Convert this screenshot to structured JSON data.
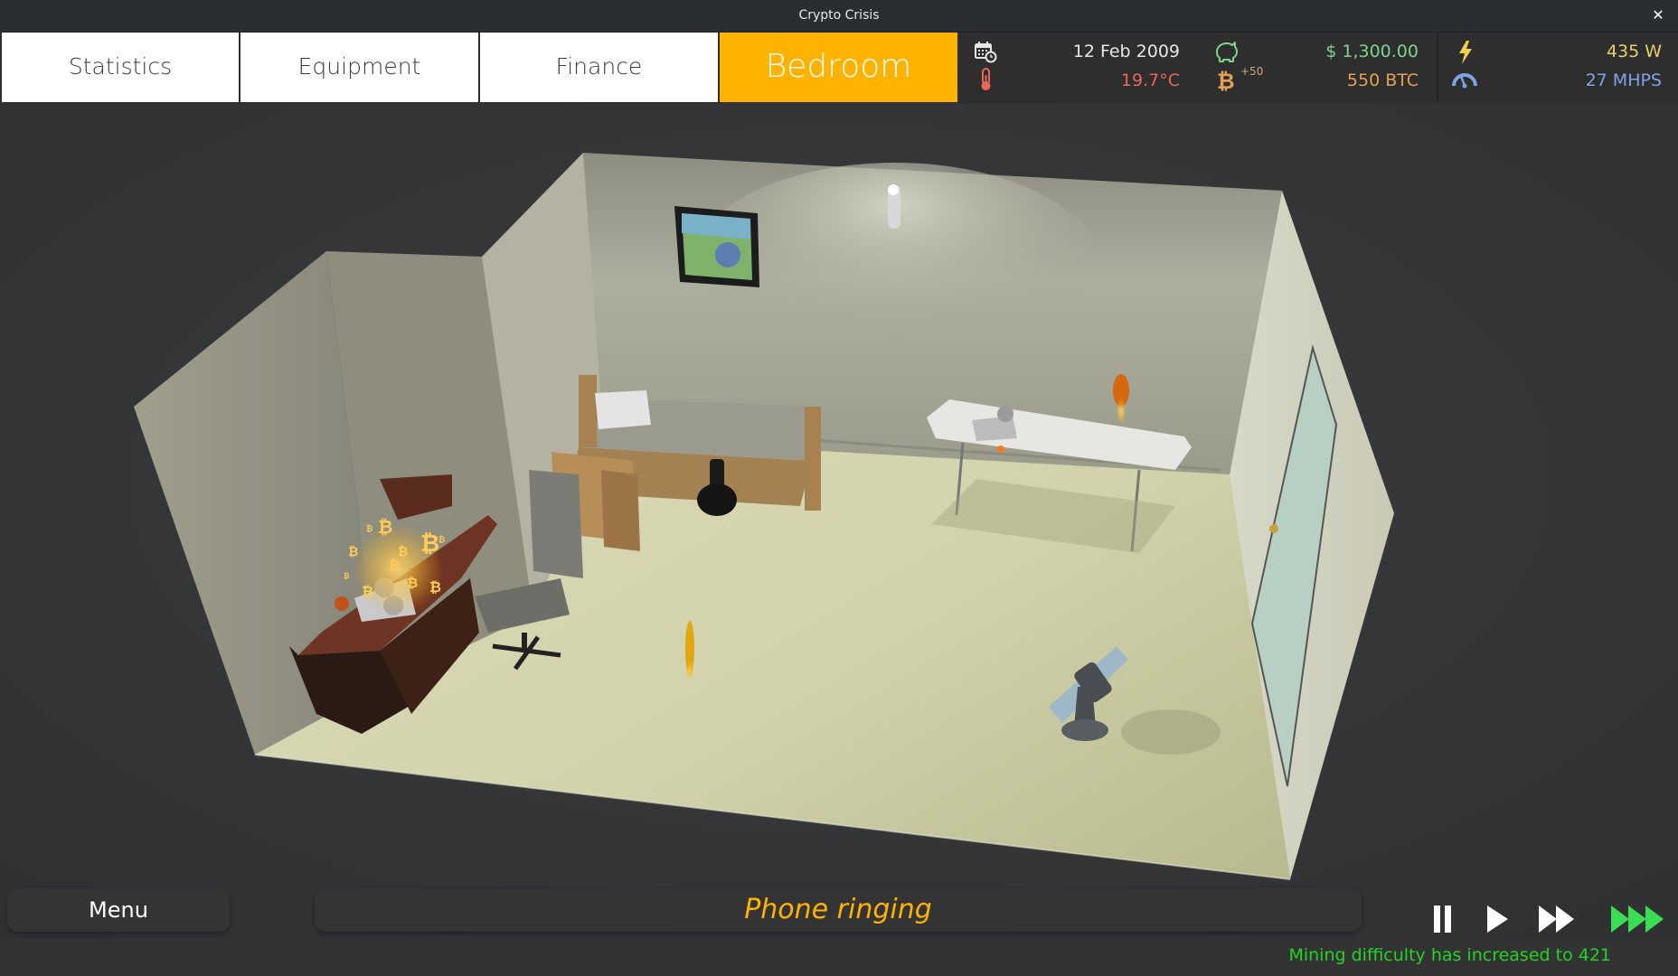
{
  "window": {
    "title": "Crypto Crisis",
    "close_icon": "close-icon"
  },
  "tabs": [
    {
      "label": "Statistics",
      "active": false
    },
    {
      "label": "Equipment",
      "active": false
    },
    {
      "label": "Finance",
      "active": false
    },
    {
      "label": "Bedroom",
      "active": true
    }
  ],
  "stats": {
    "date": {
      "icon": "calendar-clock-icon",
      "value": "12 Feb 2009",
      "color": "#e6e6e6"
    },
    "temperature": {
      "icon": "thermometer-icon",
      "value": "19.7°C",
      "color": "#e8675a"
    },
    "money": {
      "icon": "piggy-bank-icon",
      "value": "$ 1,300.00",
      "color": "#7ed38e"
    },
    "btc": {
      "icon": "bitcoin-icon",
      "value": "550 BTC",
      "delta": "+50",
      "color": "#e6a055"
    },
    "power": {
      "icon": "lightning-icon",
      "value": "435 W",
      "color": "#e8d070"
    },
    "hashrate": {
      "icon": "speedometer-icon",
      "value": "27 MHPS",
      "color": "#7ea4e6"
    }
  },
  "scene": {
    "room": "Bedroom",
    "objects": [
      "desk",
      "mining-rig",
      "office-chair",
      "nightstand",
      "bed",
      "picture-frame",
      "wall-lamp",
      "folding-table",
      "mining-rig-2",
      "wall-clock",
      "floor-fan",
      "door",
      "coin",
      "phone"
    ]
  },
  "bottom": {
    "menu_label": "Menu",
    "notification": "Phone ringing",
    "speed_controls": [
      {
        "name": "pause",
        "icon": "pause-icon",
        "active": false
      },
      {
        "name": "play",
        "icon": "play-icon",
        "active": false
      },
      {
        "name": "fast",
        "icon": "fast-forward-icon",
        "active": false
      },
      {
        "name": "fastest",
        "icon": "fastest-forward-icon",
        "active": true
      }
    ],
    "active_speed_color": "#3ddc55"
  },
  "status_message": "Mining difficulty has increased to 421"
}
